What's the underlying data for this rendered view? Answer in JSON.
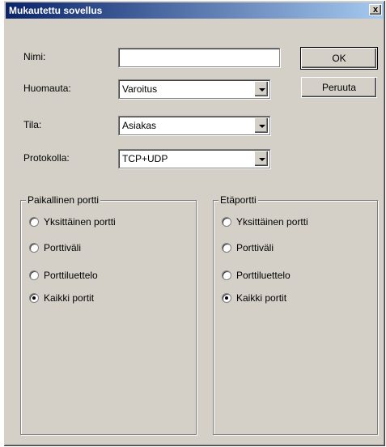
{
  "window": {
    "title": "Mukautettu sovellus",
    "close_label": "x"
  },
  "form": {
    "name_label": "Nimi:",
    "name_value": "",
    "note_label": "Huomauta:",
    "note_value": "Varoitus",
    "state_label": "Tila:",
    "state_value": "Asiakas",
    "protocol_label": "Protokolla:",
    "protocol_value": "TCP+UDP"
  },
  "buttons": {
    "ok_label": "OK",
    "cancel_label": "Peruuta"
  },
  "local_port": {
    "title": "Paikallinen portti",
    "options": [
      {
        "label": "Yksittäinen portti",
        "checked": false
      },
      {
        "label": "Porttiväli",
        "checked": false
      },
      {
        "label": "Porttiluettelo",
        "checked": false
      },
      {
        "label": "Kaikki portit",
        "checked": true
      }
    ]
  },
  "remote_port": {
    "title": "Etäportti",
    "options": [
      {
        "label": "Yksittäinen portti",
        "checked": false
      },
      {
        "label": "Porttiväli",
        "checked": false
      },
      {
        "label": "Porttiluettelo",
        "checked": false
      },
      {
        "label": "Kaikki portit",
        "checked": true
      }
    ]
  }
}
